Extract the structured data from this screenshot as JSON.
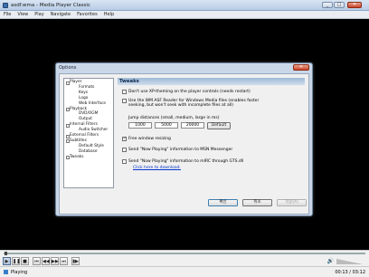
{
  "window": {
    "title": "asdf.wma - Media Player Classic",
    "minimize": "_",
    "maximize": "□",
    "close": "✕"
  },
  "menu": [
    "File",
    "View",
    "Play",
    "Navigate",
    "Favorites",
    "Help"
  ],
  "controls": {
    "play": "▶",
    "pause": "❚❚",
    "stop": "■",
    "prev": "⏮",
    "back": "◀◀",
    "fwd": "▶▶",
    "next": "⏭",
    "frame": "▮▶",
    "volume_icon": "🔊"
  },
  "status": {
    "text": "Playing",
    "time": "00:13 / 03:12"
  },
  "dialog": {
    "title": "Options",
    "close": "✕",
    "tree": [
      {
        "label": "Player",
        "level": 0
      },
      {
        "label": "Formats",
        "level": 1
      },
      {
        "label": "Keys",
        "level": 1
      },
      {
        "label": "Logo",
        "level": 1
      },
      {
        "label": "Web Interface",
        "level": 1
      },
      {
        "label": "Playback",
        "level": 0
      },
      {
        "label": "DVD/OGM",
        "level": 1
      },
      {
        "label": "Output",
        "level": 1
      },
      {
        "label": "Internal Filters",
        "level": 0
      },
      {
        "label": "Audio Switcher",
        "level": 1
      },
      {
        "label": "External Filters",
        "level": 0
      },
      {
        "label": "Subtitles",
        "level": 0
      },
      {
        "label": "Default Style",
        "level": 1
      },
      {
        "label": "Database",
        "level": 1
      },
      {
        "label": "Tweaks",
        "level": 0
      }
    ],
    "panel_title": "Tweaks",
    "options": {
      "xp_theming": "Don't use XP-theming on the player controls (needs restart)",
      "wm_asf": "Use the WM ASF Reader for Windows Media files (enables faster seeking, but won't seek with incomplete files at all)",
      "jump_label": "Jump distances (small, medium, large in ms)",
      "jump_small": "1000",
      "jump_medium": "5000",
      "jump_large": "20000",
      "default_button": "Default",
      "free_resize": "Free window resizing",
      "free_resize_checked": "✓",
      "msn": "Send \"Now Playing\" information to MSN Messenger",
      "mirc": "Send \"Now Playing\" information to mIRC through GTS.dll",
      "download_link": "Click here to download."
    },
    "buttons": {
      "ok": "확인",
      "cancel": "취소",
      "apply": "적용(A)"
    }
  }
}
